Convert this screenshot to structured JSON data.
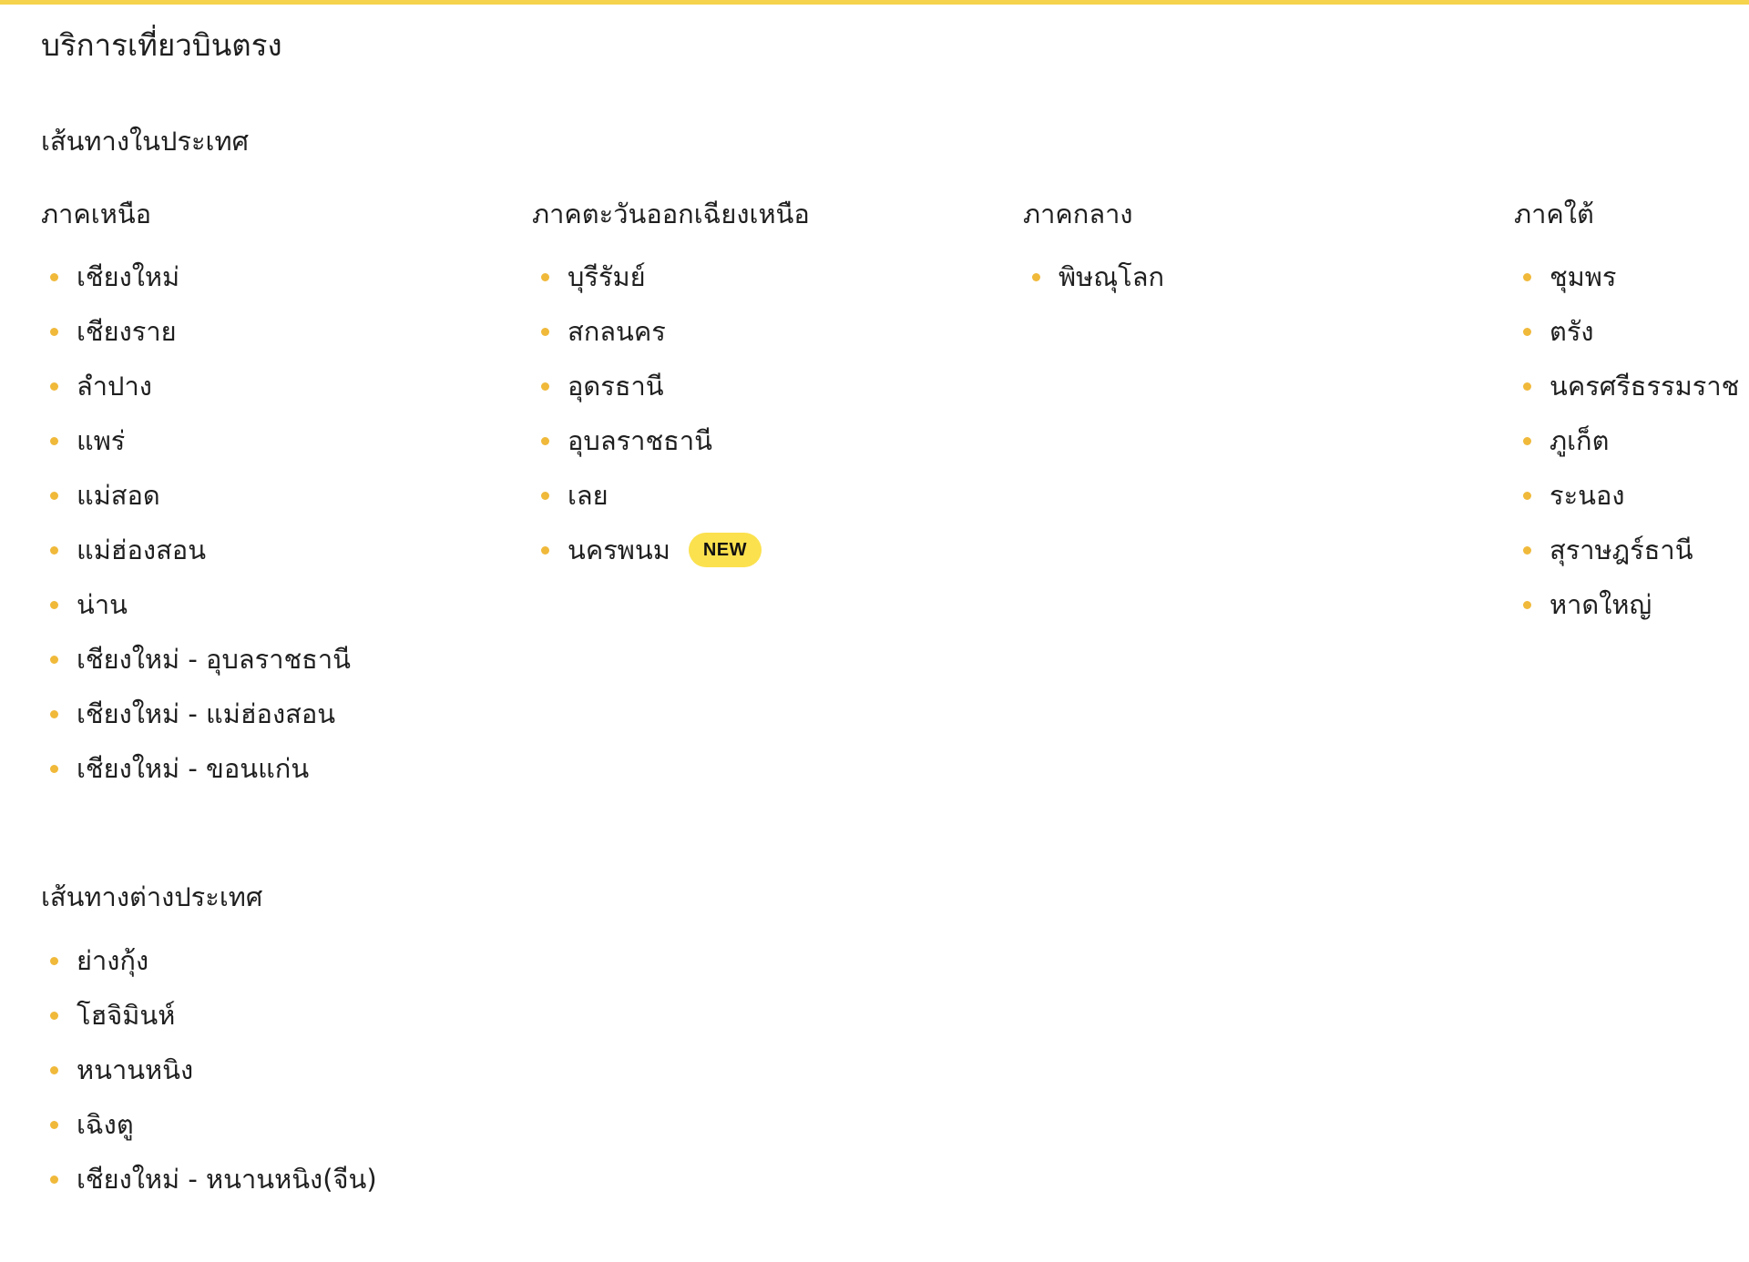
{
  "colors": {
    "accent_bar": "#f6d34c",
    "bullet": "#f0b93a",
    "badge_bg": "#fbe14e",
    "text": "#1f1f1f"
  },
  "page": {
    "title": "บริการเที่ยวบินตรง"
  },
  "domestic": {
    "heading": "เส้นทางในประเทศ",
    "regions": [
      {
        "title": "ภาคเหนือ",
        "routes": [
          {
            "label": "เชียงใหม่"
          },
          {
            "label": "เชียงราย"
          },
          {
            "label": "ลำปาง"
          },
          {
            "label": "แพร่"
          },
          {
            "label": "แม่สอด"
          },
          {
            "label": "แม่ฮ่องสอน"
          },
          {
            "label": "น่าน"
          },
          {
            "label": "เชียงใหม่ - อุบลราชธานี"
          },
          {
            "label": "เชียงใหม่ - แม่ฮ่องสอน"
          },
          {
            "label": "เชียงใหม่ - ขอนแก่น"
          }
        ]
      },
      {
        "title": "ภาคตะวันออกเฉียงเหนือ",
        "routes": [
          {
            "label": "บุรีรัมย์"
          },
          {
            "label": "สกลนคร"
          },
          {
            "label": "อุดรธานี"
          },
          {
            "label": "อุบลราชธานี"
          },
          {
            "label": "เลย"
          },
          {
            "label": "นครพนม",
            "badge": "NEW"
          }
        ]
      },
      {
        "title": "ภาคกลาง",
        "routes": [
          {
            "label": "พิษณุโลก"
          }
        ]
      },
      {
        "title": "ภาคใต้",
        "routes": [
          {
            "label": "ชุมพร"
          },
          {
            "label": "ตรัง"
          },
          {
            "label": "นครศรีธรรมราช"
          },
          {
            "label": "ภูเก็ต"
          },
          {
            "label": "ระนอง"
          },
          {
            "label": "สุราษฎร์ธานี"
          },
          {
            "label": "หาดใหญ่"
          }
        ]
      }
    ]
  },
  "international": {
    "heading": "เส้นทางต่างประเทศ",
    "routes": [
      {
        "label": "ย่างกุ้ง"
      },
      {
        "label": "โฮจิมินห์"
      },
      {
        "label": "หนานหนิง"
      },
      {
        "label": "เฉิงตู"
      },
      {
        "label": "เชียงใหม่ - หนานหนิง(จีน)"
      }
    ]
  }
}
